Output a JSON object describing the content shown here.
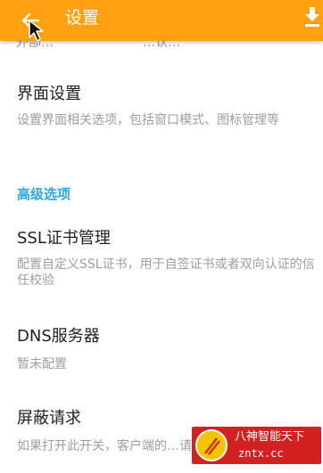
{
  "app_bar": {
    "title": "设置",
    "back_icon": "arrow-left-icon",
    "download_icon": "download-icon",
    "background": "#ffa113"
  },
  "partial_top": {
    "left": "外部…",
    "right": "…认…"
  },
  "preferences": [
    {
      "title": "界面设置",
      "summary": "设置界面相关选项，包括窗口模式、图标管理等"
    }
  ],
  "categories": [
    {
      "title": "高级选项",
      "color": "#2ea7e0",
      "items": [
        {
          "title": "SSL证书管理",
          "summary": "配置自定义SSL证书，用于自签证书或者双向认证的信任校验"
        },
        {
          "title": "DNS服务器",
          "summary": "暂未配置"
        },
        {
          "title": "屏蔽请求",
          "summary": "如果打开此开关，客户端的…请求不会发给服务器"
        }
      ]
    }
  ],
  "watermark": {
    "name": "八神智能天下",
    "domain": "zntx.cc"
  }
}
